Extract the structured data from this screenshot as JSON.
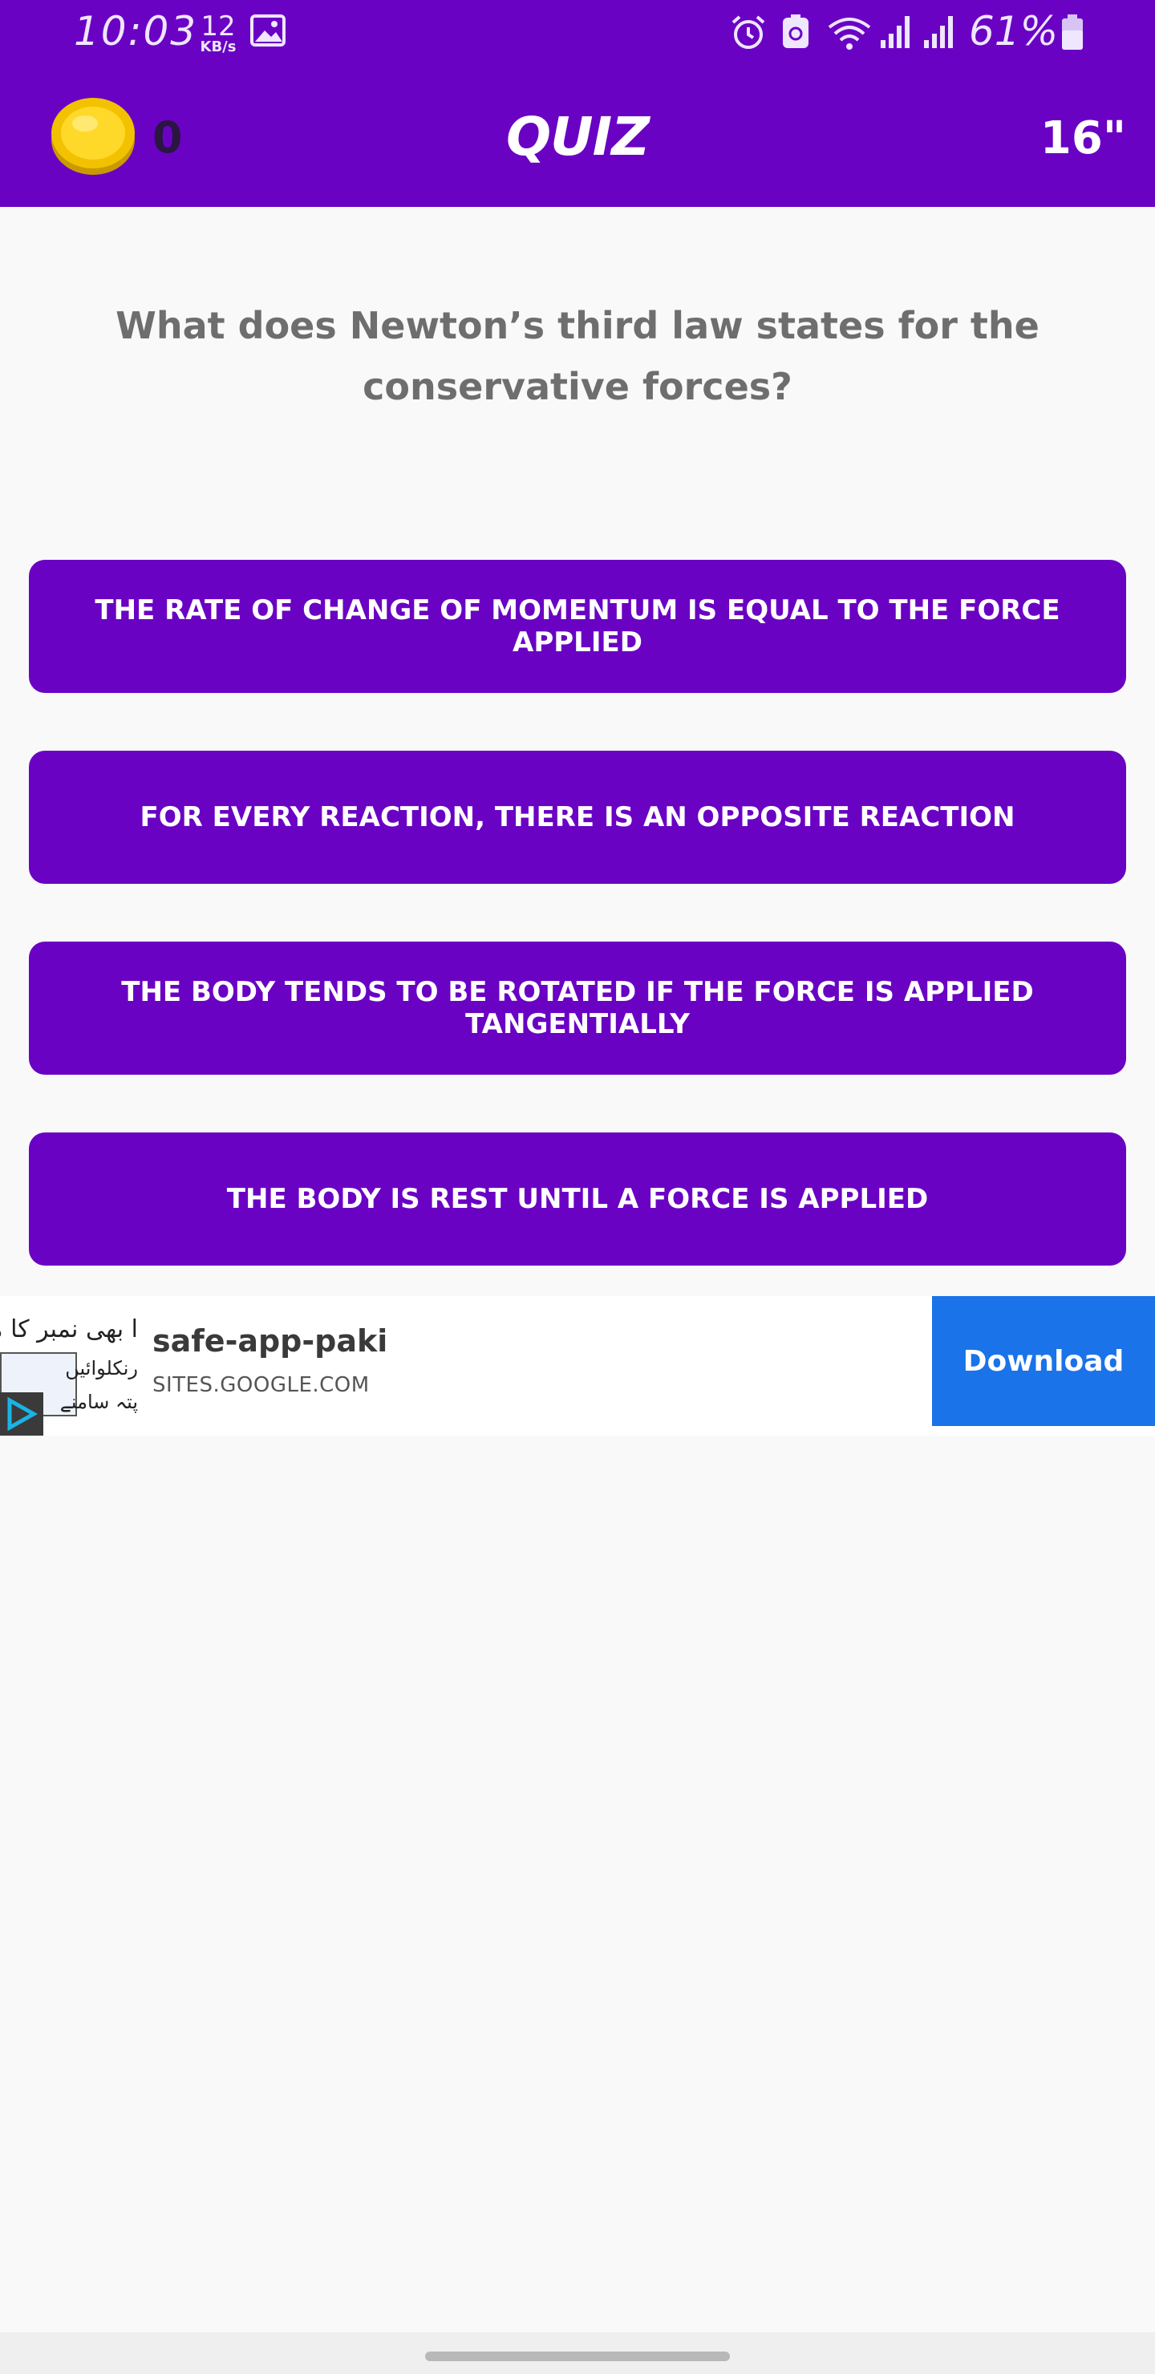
{
  "status_bar": {
    "time": "10:03",
    "net_speed_value": "12",
    "net_speed_unit": "KB/s",
    "battery_percent": "61%",
    "icons": [
      "image-icon",
      "alarm-icon",
      "nfc-icon",
      "wifi-icon",
      "signal-icon",
      "signal-icon",
      "battery-icon"
    ]
  },
  "header": {
    "coin_count": "0",
    "title": "QUIZ",
    "timer": "16\""
  },
  "question": {
    "text": "What does Newton’s third law states for the conservative forces?"
  },
  "answers": [
    {
      "label": "THE RATE OF CHANGE OF MOMENTUM IS EQUAL TO THE FORCE APPLIED"
    },
    {
      "label": "FOR EVERY REACTION, THERE IS AN OPPOSITE REACTION"
    },
    {
      "label": "THE BODY TENDS TO BE ROTATED IF THE FORCE IS APPLIED TANGENTIALLY"
    },
    {
      "label": "THE BODY IS REST UNTIL A FORCE IS APPLIED"
    }
  ],
  "ad": {
    "title": "safe-app-paki",
    "url": "SITES.GOOGLE.COM",
    "button_label": "Download",
    "thumb_text_1": "ا بھی نمبر کا مکمل ریکارڈ",
    "thumb_text_2": "رنکلوائیں",
    "thumb_text_3": "پتہ سامنے"
  },
  "colors": {
    "primary": "#6a02c4",
    "background": "#f9f9f9",
    "ad_button": "#1a73e8",
    "question_text": "#6e6e6e"
  }
}
